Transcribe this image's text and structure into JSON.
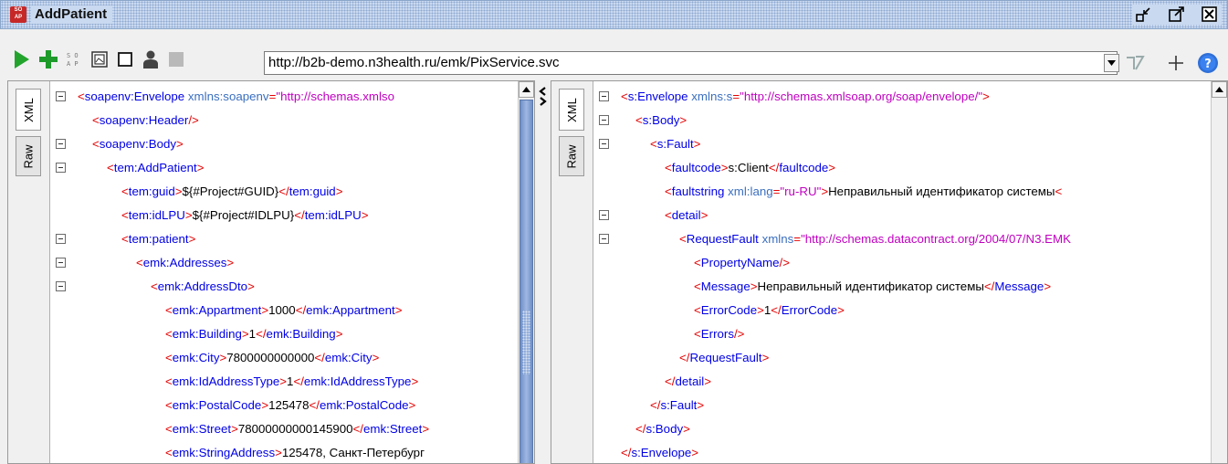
{
  "window": {
    "title": "AddPatient",
    "logo_text": "SO AP",
    "buttons": [
      "restore-icon",
      "maximize-icon",
      "close-icon"
    ]
  },
  "toolbar": {
    "icons": [
      "run-icon",
      "add-icon",
      "wsdl-icon",
      "image-icon",
      "checkbox-icon",
      "user-icon",
      "stop-icon"
    ],
    "url": "http://b2b-demo.n3health.ru/emk/PixService.svc",
    "right_icons": [
      "tag-icon",
      "plus-icon",
      "help-icon"
    ],
    "help_label": "?"
  },
  "request_panel": {
    "tabs": [
      "XML",
      "Raw"
    ],
    "active_tab": "XML"
  },
  "response_panel": {
    "tabs": [
      "XML",
      "Raw"
    ],
    "active_tab": "XML"
  },
  "request_lines": [
    {
      "indent": 0,
      "fold": true,
      "parts": [
        [
          "br",
          "<"
        ],
        [
          "tag",
          "soapenv:Envelope"
        ],
        [
          "plain",
          " "
        ],
        [
          "attr",
          "xmlns:soapenv"
        ],
        [
          "br",
          "="
        ],
        [
          "val",
          "\"http://schemas.xmlso"
        ]
      ]
    },
    {
      "indent": 1,
      "fold": false,
      "parts": [
        [
          "br",
          "<"
        ],
        [
          "tag",
          "soapenv:Header"
        ],
        [
          "br",
          "/>"
        ]
      ]
    },
    {
      "indent": 1,
      "fold": true,
      "parts": [
        [
          "br",
          "<"
        ],
        [
          "tag",
          "soapenv:Body"
        ],
        [
          "br",
          ">"
        ]
      ]
    },
    {
      "indent": 2,
      "fold": true,
      "parts": [
        [
          "br",
          "<"
        ],
        [
          "tag",
          "tem:AddPatient"
        ],
        [
          "br",
          ">"
        ]
      ]
    },
    {
      "indent": 3,
      "fold": false,
      "parts": [
        [
          "br",
          "<"
        ],
        [
          "tag",
          "tem:guid"
        ],
        [
          "br",
          ">"
        ],
        [
          "plain",
          "${#Project#GUID}"
        ],
        [
          "br",
          "</"
        ],
        [
          "tag",
          "tem:guid"
        ],
        [
          "br",
          ">"
        ]
      ]
    },
    {
      "indent": 3,
      "fold": false,
      "parts": [
        [
          "br",
          "<"
        ],
        [
          "tag",
          "tem:idLPU"
        ],
        [
          "br",
          ">"
        ],
        [
          "plain",
          "${#Project#IDLPU}"
        ],
        [
          "br",
          "</"
        ],
        [
          "tag",
          "tem:idLPU"
        ],
        [
          "br",
          ">"
        ]
      ]
    },
    {
      "indent": 3,
      "fold": true,
      "parts": [
        [
          "br",
          "<"
        ],
        [
          "tag",
          "tem:patient"
        ],
        [
          "br",
          ">"
        ]
      ]
    },
    {
      "indent": 4,
      "fold": true,
      "parts": [
        [
          "br",
          "<"
        ],
        [
          "tag",
          "emk:Addresses"
        ],
        [
          "br",
          ">"
        ]
      ]
    },
    {
      "indent": 5,
      "fold": true,
      "parts": [
        [
          "br",
          "<"
        ],
        [
          "tag",
          "emk:AddressDto"
        ],
        [
          "br",
          ">"
        ]
      ]
    },
    {
      "indent": 6,
      "fold": false,
      "parts": [
        [
          "br",
          "<"
        ],
        [
          "tag",
          "emk:Appartment"
        ],
        [
          "br",
          ">"
        ],
        [
          "plain",
          "1000"
        ],
        [
          "br",
          "</"
        ],
        [
          "tag",
          "emk:Appartment"
        ],
        [
          "br",
          ">"
        ]
      ]
    },
    {
      "indent": 6,
      "fold": false,
      "parts": [
        [
          "br",
          "<"
        ],
        [
          "tag",
          "emk:Building"
        ],
        [
          "br",
          ">"
        ],
        [
          "plain",
          "1"
        ],
        [
          "br",
          "</"
        ],
        [
          "tag",
          "emk:Building"
        ],
        [
          "br",
          ">"
        ]
      ]
    },
    {
      "indent": 6,
      "fold": false,
      "parts": [
        [
          "br",
          "<"
        ],
        [
          "tag",
          "emk:City"
        ],
        [
          "br",
          ">"
        ],
        [
          "plain",
          "7800000000000"
        ],
        [
          "br",
          "</"
        ],
        [
          "tag",
          "emk:City"
        ],
        [
          "br",
          ">"
        ]
      ]
    },
    {
      "indent": 6,
      "fold": false,
      "parts": [
        [
          "br",
          "<"
        ],
        [
          "tag",
          "emk:IdAddressType"
        ],
        [
          "br",
          ">"
        ],
        [
          "plain",
          "1"
        ],
        [
          "br",
          "</"
        ],
        [
          "tag",
          "emk:IdAddressType"
        ],
        [
          "br",
          ">"
        ]
      ]
    },
    {
      "indent": 6,
      "fold": false,
      "parts": [
        [
          "br",
          "<"
        ],
        [
          "tag",
          "emk:PostalCode"
        ],
        [
          "br",
          ">"
        ],
        [
          "plain",
          "125478"
        ],
        [
          "br",
          "</"
        ],
        [
          "tag",
          "emk:PostalCode"
        ],
        [
          "br",
          ">"
        ]
      ]
    },
    {
      "indent": 6,
      "fold": false,
      "parts": [
        [
          "br",
          "<"
        ],
        [
          "tag",
          "emk:Street"
        ],
        [
          "br",
          ">"
        ],
        [
          "plain",
          "78000000000145900"
        ],
        [
          "br",
          "</"
        ],
        [
          "tag",
          "emk:Street"
        ],
        [
          "br",
          ">"
        ]
      ]
    },
    {
      "indent": 6,
      "fold": false,
      "parts": [
        [
          "br",
          "<"
        ],
        [
          "tag",
          "emk:StringAddress"
        ],
        [
          "br",
          ">"
        ],
        [
          "plain",
          "125478, Санкт-Петербург"
        ]
      ]
    }
  ],
  "response_lines": [
    {
      "indent": 0,
      "fold": true,
      "parts": [
        [
          "br",
          "<"
        ],
        [
          "tag",
          "s:Envelope"
        ],
        [
          "plain",
          " "
        ],
        [
          "attr",
          "xmlns:s"
        ],
        [
          "br",
          "="
        ],
        [
          "val",
          "\"http://schemas.xmlsoap.org/soap/envelope/\""
        ],
        [
          "br",
          ">"
        ]
      ]
    },
    {
      "indent": 1,
      "fold": true,
      "parts": [
        [
          "br",
          "<"
        ],
        [
          "tag",
          "s:Body"
        ],
        [
          "br",
          ">"
        ]
      ]
    },
    {
      "indent": 2,
      "fold": true,
      "parts": [
        [
          "br",
          "<"
        ],
        [
          "tag",
          "s:Fault"
        ],
        [
          "br",
          ">"
        ]
      ]
    },
    {
      "indent": 3,
      "fold": false,
      "parts": [
        [
          "br",
          "<"
        ],
        [
          "tag",
          "faultcode"
        ],
        [
          "br",
          ">"
        ],
        [
          "plain",
          "s:Client"
        ],
        [
          "br",
          "</"
        ],
        [
          "tag",
          "faultcode"
        ],
        [
          "br",
          ">"
        ]
      ]
    },
    {
      "indent": 3,
      "fold": false,
      "parts": [
        [
          "br",
          "<"
        ],
        [
          "tag",
          "faultstring"
        ],
        [
          "plain",
          " "
        ],
        [
          "attr",
          "xml:lang"
        ],
        [
          "br",
          "="
        ],
        [
          "val",
          "\"ru-RU\""
        ],
        [
          "br",
          ">"
        ],
        [
          "plain",
          "Неправильный идентификатор системы"
        ],
        [
          "br",
          "<"
        ]
      ]
    },
    {
      "indent": 3,
      "fold": true,
      "parts": [
        [
          "br",
          "<"
        ],
        [
          "tag",
          "detail"
        ],
        [
          "br",
          ">"
        ]
      ]
    },
    {
      "indent": 4,
      "fold": true,
      "parts": [
        [
          "br",
          "<"
        ],
        [
          "tag",
          "RequestFault"
        ],
        [
          "plain",
          " "
        ],
        [
          "attr",
          "xmlns"
        ],
        [
          "br",
          "="
        ],
        [
          "val",
          "\"http://schemas.datacontract.org/2004/07/N3.EMK"
        ]
      ]
    },
    {
      "indent": 5,
      "fold": false,
      "parts": [
        [
          "br",
          "<"
        ],
        [
          "tag",
          "PropertyName"
        ],
        [
          "br",
          "/>"
        ]
      ]
    },
    {
      "indent": 5,
      "fold": false,
      "parts": [
        [
          "br",
          "<"
        ],
        [
          "tag",
          "Message"
        ],
        [
          "br",
          ">"
        ],
        [
          "plain",
          "Неправильный идентификатор системы"
        ],
        [
          "br",
          "</"
        ],
        [
          "tag",
          "Message"
        ],
        [
          "br",
          ">"
        ]
      ]
    },
    {
      "indent": 5,
      "fold": false,
      "parts": [
        [
          "br",
          "<"
        ],
        [
          "tag",
          "ErrorCode"
        ],
        [
          "br",
          ">"
        ],
        [
          "plain",
          "1"
        ],
        [
          "br",
          "</"
        ],
        [
          "tag",
          "ErrorCode"
        ],
        [
          "br",
          ">"
        ]
      ]
    },
    {
      "indent": 5,
      "fold": false,
      "parts": [
        [
          "br",
          "<"
        ],
        [
          "tag",
          "Errors"
        ],
        [
          "br",
          "/>"
        ]
      ]
    },
    {
      "indent": 4,
      "fold": false,
      "parts": [
        [
          "br",
          "</"
        ],
        [
          "tag",
          "RequestFault"
        ],
        [
          "br",
          ">"
        ]
      ]
    },
    {
      "indent": 3,
      "fold": false,
      "parts": [
        [
          "br",
          "</"
        ],
        [
          "tag",
          "detail"
        ],
        [
          "br",
          ">"
        ]
      ]
    },
    {
      "indent": 2,
      "fold": false,
      "parts": [
        [
          "br",
          "</"
        ],
        [
          "tag",
          "s:Fault"
        ],
        [
          "br",
          ">"
        ]
      ]
    },
    {
      "indent": 1,
      "fold": false,
      "parts": [
        [
          "br",
          "</"
        ],
        [
          "tag",
          "s:Body"
        ],
        [
          "br",
          ">"
        ]
      ]
    },
    {
      "indent": 0,
      "fold": false,
      "parts": [
        [
          "br",
          "</"
        ],
        [
          "tag",
          "s:Envelope"
        ],
        [
          "br",
          ">"
        ]
      ]
    }
  ]
}
